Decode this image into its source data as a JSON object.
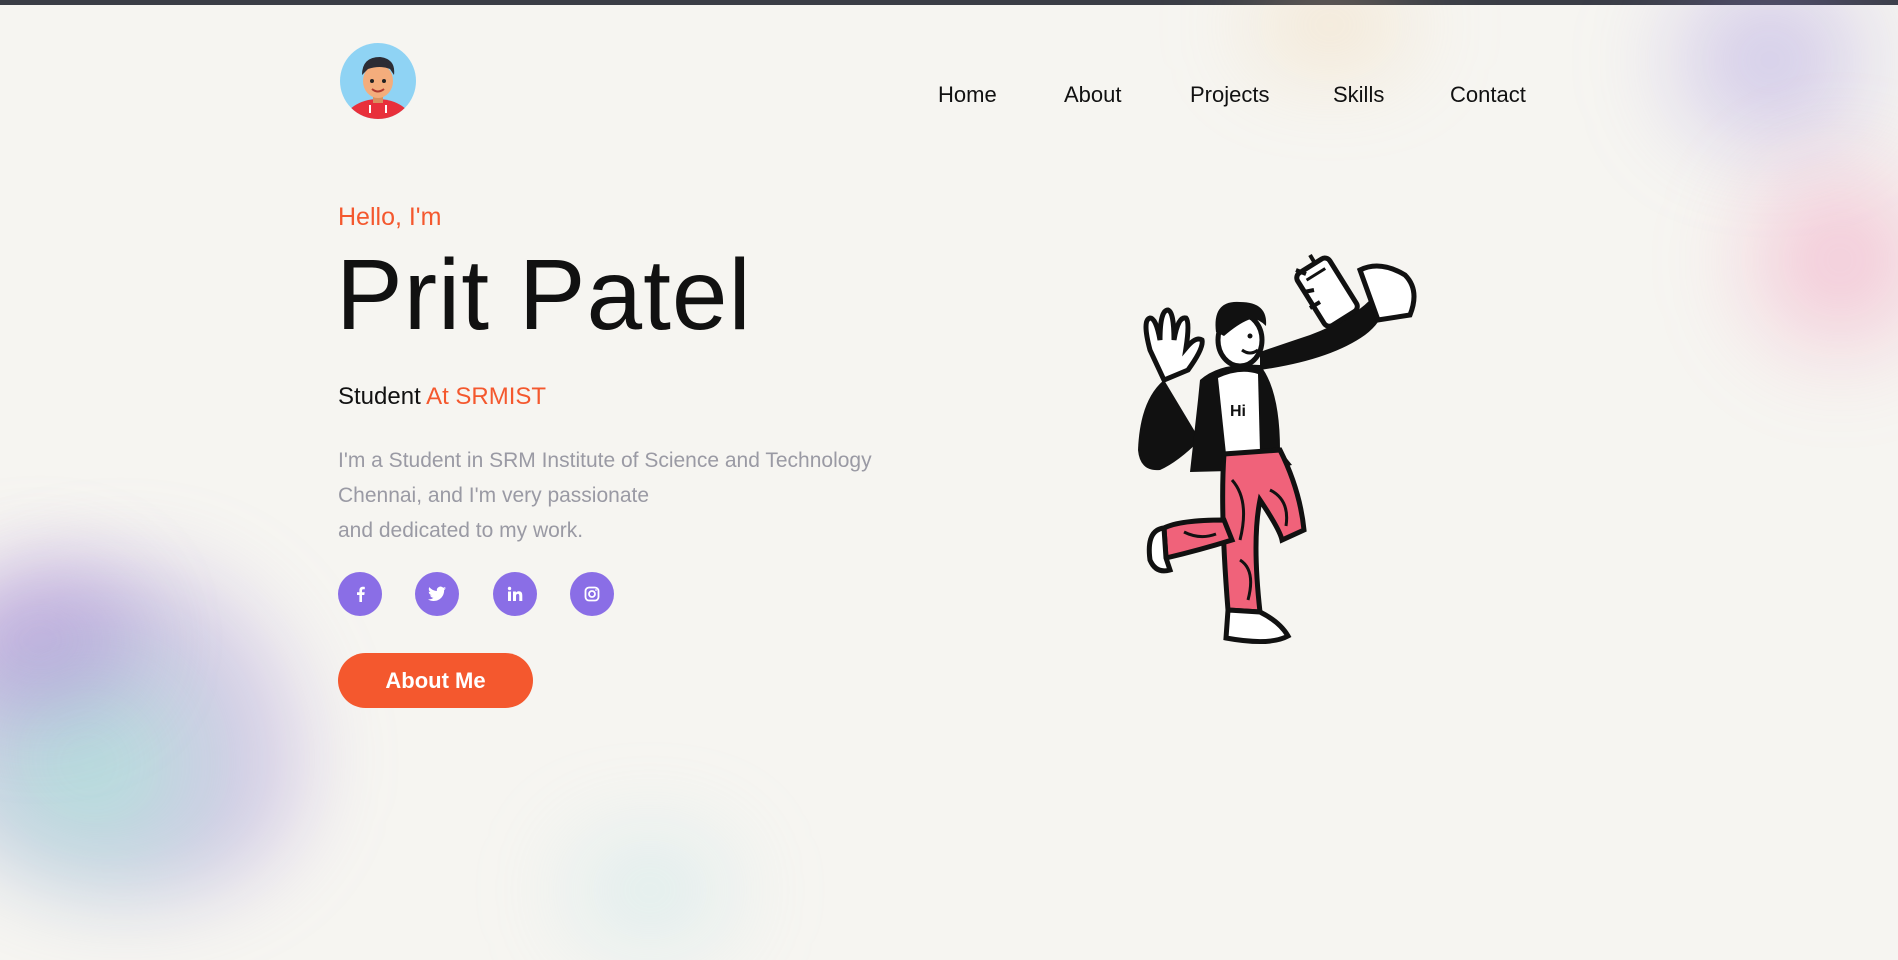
{
  "nav": {
    "items": [
      "Home",
      "About",
      "Projects",
      "Skills",
      "Contact"
    ]
  },
  "hero": {
    "greeting": "Hello, I'm",
    "name": "Prit Patel",
    "role_prefix": "Student",
    "role_highlight": "At SRMIST",
    "description_lines": [
      "I'm a Student in SRM Institute of Science and Technology",
      "Chennai, and I'm very passionate",
      "and dedicated to my work."
    ],
    "socials": [
      "facebook-icon",
      "twitter-icon",
      "linkedin-icon",
      "instagram-icon"
    ],
    "cta_label": "About Me",
    "illustration_text": "Hi"
  },
  "colors": {
    "accent": "#f4582e",
    "social_bg": "#8a6ee6",
    "background": "#f6f5f1",
    "text": "#111111",
    "muted": "#9a9aa4",
    "pants": "#f0627a"
  }
}
